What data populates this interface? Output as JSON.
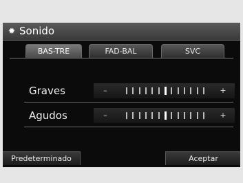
{
  "header": {
    "title": "Sonido",
    "icon": "gear-icon"
  },
  "tabs": [
    {
      "label": "BAS-TRE",
      "active": true
    },
    {
      "label": "FAD-BAL",
      "active": false
    },
    {
      "label": "SVC",
      "active": false
    }
  ],
  "settings": [
    {
      "label": "Graves",
      "minus": "–",
      "plus": "+",
      "level": 0
    },
    {
      "label": "Agudos",
      "minus": "–",
      "plus": "+",
      "level": 0
    }
  ],
  "slider": {
    "min": -6,
    "max": 6,
    "tick_count": 13
  },
  "buttons": {
    "reset": "Predeterminado",
    "accept": "Aceptar"
  }
}
